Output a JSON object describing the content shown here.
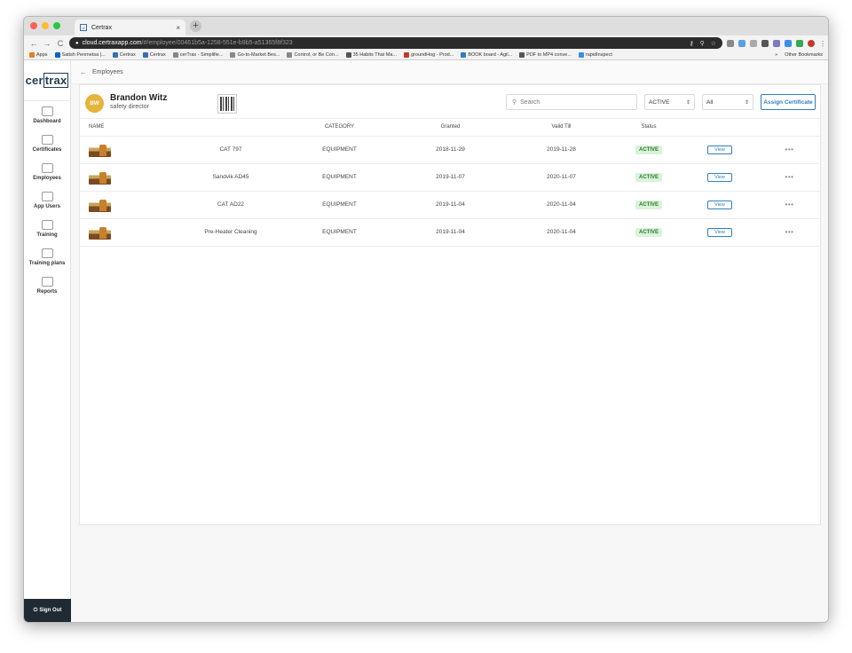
{
  "browser": {
    "tab_title": "Certrax",
    "favicon_text": "ct",
    "close_glyph": "×",
    "new_tab_glyph": "+",
    "url_host": "cloud.certraxapp.com",
    "url_path": "/#/employee/00461b5a-1258-551e-b9b5-a51365f8f323",
    "back_glyph": "←",
    "forward_glyph": "→",
    "reload_glyph": "C",
    "bookmarks": [
      {
        "label": "Apps",
        "color": "#e67e22"
      },
      {
        "label": "Satish Penmetsa |...",
        "color": "#0a66c2"
      },
      {
        "label": "Certrax",
        "color": "#3a6fb0"
      },
      {
        "label": "Certrax",
        "color": "#3a6fb0"
      },
      {
        "label": "cerTrax - Simplifie...",
        "color": "#888888"
      },
      {
        "label": "Go-to-Market Bes...",
        "color": "#888888"
      },
      {
        "label": "Control, or Be Con...",
        "color": "#888888"
      },
      {
        "label": "35 Habits That Ma...",
        "color": "#555555"
      },
      {
        "label": "groundHog - Prod...",
        "color": "#c0392b"
      },
      {
        "label": "BOOK board - Agil...",
        "color": "#2f7fc1"
      },
      {
        "label": "PDF to MP4 conve...",
        "color": "#555555"
      },
      {
        "label": "rapidInspect",
        "color": "#3a8ee6"
      }
    ],
    "bookmarks_overflow": "»",
    "other_bookmarks": "Other Bookmarks"
  },
  "sidebar": {
    "logo_left": "cer",
    "logo_boxed": "trax",
    "items": [
      {
        "label": "Dashboard"
      },
      {
        "label": "Certificates"
      },
      {
        "label": "Employees"
      },
      {
        "label": "App Users"
      },
      {
        "label": "Training"
      },
      {
        "label": "Training plans"
      },
      {
        "label": "Reports"
      }
    ],
    "sign_out": "Sign Out",
    "sign_out_icon": "⏻"
  },
  "breadcrumb": {
    "back_glyph": "←",
    "label": "Employees"
  },
  "employee": {
    "initials": "BW",
    "name": "Brandon Witz",
    "role": "safety director"
  },
  "toolbar": {
    "search_placeholder": "Search",
    "search_glyph": "⚲",
    "status_filter": "ACTIVE",
    "category_filter": "All",
    "select_arrow": "⇕",
    "assign_label": "Assign Certificate"
  },
  "table": {
    "headers": [
      "NAME",
      "",
      "CATEGORY",
      "Granted",
      "Valid Till",
      "Status",
      "",
      ""
    ],
    "rows": [
      {
        "name": "CAT 797",
        "category": "EQUIPMENT",
        "granted": "2018-11-29",
        "valid_till": "2019-11-28",
        "status": "ACTIVE",
        "action": "View",
        "more": "•••"
      },
      {
        "name": "Sandvik AD45",
        "category": "EQUIPMENT",
        "granted": "2019-11-07",
        "valid_till": "2020-11-07",
        "status": "ACTIVE",
        "action": "View",
        "more": "•••"
      },
      {
        "name": "CAT AD22",
        "category": "EQUIPMENT",
        "granted": "2019-11-04",
        "valid_till": "2020-11-04",
        "status": "ACTIVE",
        "action": "View",
        "more": "•••"
      },
      {
        "name": "Pre-Heater Cleaning",
        "category": "EQUIPMENT",
        "granted": "2019-11-04",
        "valid_till": "2020-11-04",
        "status": "ACTIVE",
        "action": "View",
        "more": "•••"
      }
    ]
  },
  "colors": {
    "accent": "#2f7fc1",
    "avatar": "#e6b33b",
    "status_bg": "#d9f2d9",
    "status_text": "#2a7a2a",
    "sidebar_dark": "#1f2a33"
  }
}
